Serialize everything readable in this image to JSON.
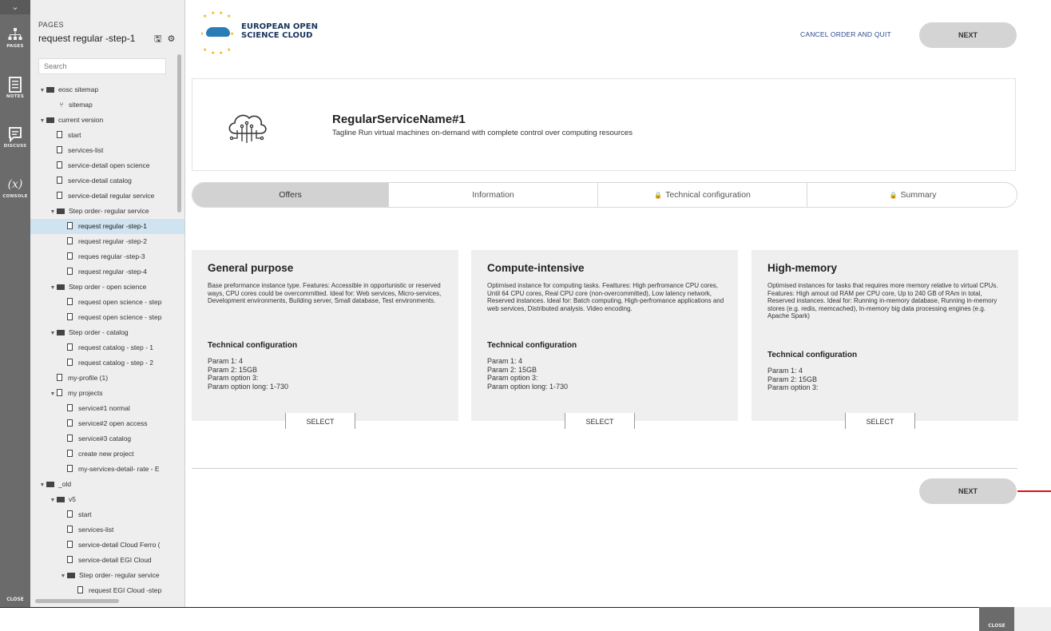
{
  "rail": {
    "items": [
      {
        "label": "PAGES",
        "icon": "sitemap-icon"
      },
      {
        "label": "NOTES",
        "icon": "notes-icon"
      },
      {
        "label": "DISCUSS",
        "icon": "discuss-icon"
      },
      {
        "label": "CONSOLE",
        "icon": "console-icon",
        "glyph": "(x)"
      }
    ],
    "close_label": "CLOSE"
  },
  "panel": {
    "section_label": "PAGES",
    "title": "request regular -step-1",
    "search_placeholder": "Search"
  },
  "tree": [
    {
      "label": "eosc sitemap",
      "kind": "folder",
      "depth": 0,
      "toggle": "▼"
    },
    {
      "label": "sitemap",
      "kind": "sitemap",
      "depth": 1
    },
    {
      "label": "current version",
      "kind": "folder",
      "depth": 0,
      "toggle": "▼"
    },
    {
      "label": "start",
      "kind": "page",
      "depth": 1
    },
    {
      "label": "services-list",
      "kind": "page",
      "depth": 1
    },
    {
      "label": "service-detail open science",
      "kind": "page",
      "depth": 1
    },
    {
      "label": "service-detail catalog",
      "kind": "page",
      "depth": 1
    },
    {
      "label": "service-detail regular service",
      "kind": "page",
      "depth": 1
    },
    {
      "label": "Step order- regular service",
      "kind": "folder",
      "depth": 1,
      "toggle": "▼"
    },
    {
      "label": "request regular -step-1",
      "kind": "page",
      "depth": 2,
      "selected": true
    },
    {
      "label": "request regular -step-2",
      "kind": "page",
      "depth": 2
    },
    {
      "label": "reques regular -step-3",
      "kind": "page",
      "depth": 2
    },
    {
      "label": "request regular -step-4",
      "kind": "page",
      "depth": 2
    },
    {
      "label": "Step order - open science",
      "kind": "folder",
      "depth": 1,
      "toggle": "▼"
    },
    {
      "label": "request open science - step",
      "kind": "page",
      "depth": 2
    },
    {
      "label": "request open science - step",
      "kind": "page",
      "depth": 2
    },
    {
      "label": "Step order - catalog",
      "kind": "folder",
      "depth": 1,
      "toggle": "▼"
    },
    {
      "label": "request catalog - step - 1",
      "kind": "page",
      "depth": 2
    },
    {
      "label": "request catalog - step - 2",
      "kind": "page",
      "depth": 2
    },
    {
      "label": "my-profile (1)",
      "kind": "page",
      "depth": 1
    },
    {
      "label": "my projects",
      "kind": "page",
      "depth": 1,
      "toggle": "▼"
    },
    {
      "label": "service#1 normal",
      "kind": "page",
      "depth": 2
    },
    {
      "label": "service#2 open access",
      "kind": "page",
      "depth": 2
    },
    {
      "label": "service#3 catalog",
      "kind": "page",
      "depth": 2
    },
    {
      "label": "create new project",
      "kind": "page",
      "depth": 2
    },
    {
      "label": "my-services-detail- rate - E",
      "kind": "page",
      "depth": 2
    },
    {
      "label": "_old",
      "kind": "folder",
      "depth": 0,
      "toggle": "▼"
    },
    {
      "label": "v5",
      "kind": "folder",
      "depth": 1,
      "toggle": "▼"
    },
    {
      "label": "start",
      "kind": "page",
      "depth": 2
    },
    {
      "label": "services-list",
      "kind": "page",
      "depth": 2
    },
    {
      "label": "service-detail Cloud Ferro (",
      "kind": "page",
      "depth": 2
    },
    {
      "label": "service-detail EGI Cloud",
      "kind": "page",
      "depth": 2
    },
    {
      "label": "Step order- regular service",
      "kind": "folder",
      "depth": 2,
      "toggle": "▼"
    },
    {
      "label": "request EGI Cloud -step",
      "kind": "page",
      "depth": 3
    }
  ],
  "header": {
    "logo_line1": "EUROPEAN OPEN",
    "logo_line2": "SCIENCE CLOUD",
    "cancel_label": "CANCEL ORDER AND QUIT",
    "next_label": "NEXT",
    "accent": "#17355e"
  },
  "service": {
    "name": "RegularServiceName#1",
    "tagline": "Tagline Run virtual machines on-demand with complete control over computing resources",
    "icon": "cloud-circuit-icon"
  },
  "tabs": [
    {
      "label": "Offers",
      "active": true,
      "locked": false
    },
    {
      "label": "Information",
      "active": false,
      "locked": false
    },
    {
      "label": "Technical configuration",
      "active": false,
      "locked": true
    },
    {
      "label": "Summary",
      "active": false,
      "locked": true
    }
  ],
  "offers": [
    {
      "title": "General purpose",
      "description": "Base preformance instance type. Features: Accessible in opportunistic or reserved ways, CPU cores could be overcommitted. Ideal for: Web services, Micro-services, Development environments, Building server, Small database, Test environments.",
      "tech_title": "Technical configuration",
      "params": [
        "Param 1: 4",
        "Param 2: 15GB",
        "Param option  3:",
        "Param option long: 1-730"
      ],
      "select_label": "SELECT"
    },
    {
      "title": "Compute-intensive",
      "description": "Optimised instance for computing tasks. Feattures: High perfromance CPU cores, Until 64 CPU cores, Real CPU core (non-overcommitted), Low latency network, Reserved instances. Ideal for: Batch computing, High-perfromance applications and web services, Distributed analysis. Video encoding.",
      "tech_title": "Technical configuration",
      "params": [
        "Param 1: 4",
        "Param 2: 15GB",
        "Param option  3:",
        "Param option long: 1-730"
      ],
      "select_label": "SELECT"
    },
    {
      "title": "High-memory",
      "description": "Optimised instances for tasks that requires more memory relative to virtual CPUs. Features: High amout od RAM per CPU core, Up to 240 GB of RAm in total, Reserved instances. Ideal for: Running in-memory database, Running in-memory stores (e.g. redis, memcached), In-memory big data processing engines (e.g. Apache Spark)",
      "tech_title": "Technical configuration",
      "params": [
        "Param 1: 4",
        "Param 2: 15GB",
        "Param option  3:"
      ],
      "select_label": "SELECT"
    }
  ],
  "footer": {
    "next_label": "NEXT"
  },
  "bottom_close_label": "CLOSE"
}
